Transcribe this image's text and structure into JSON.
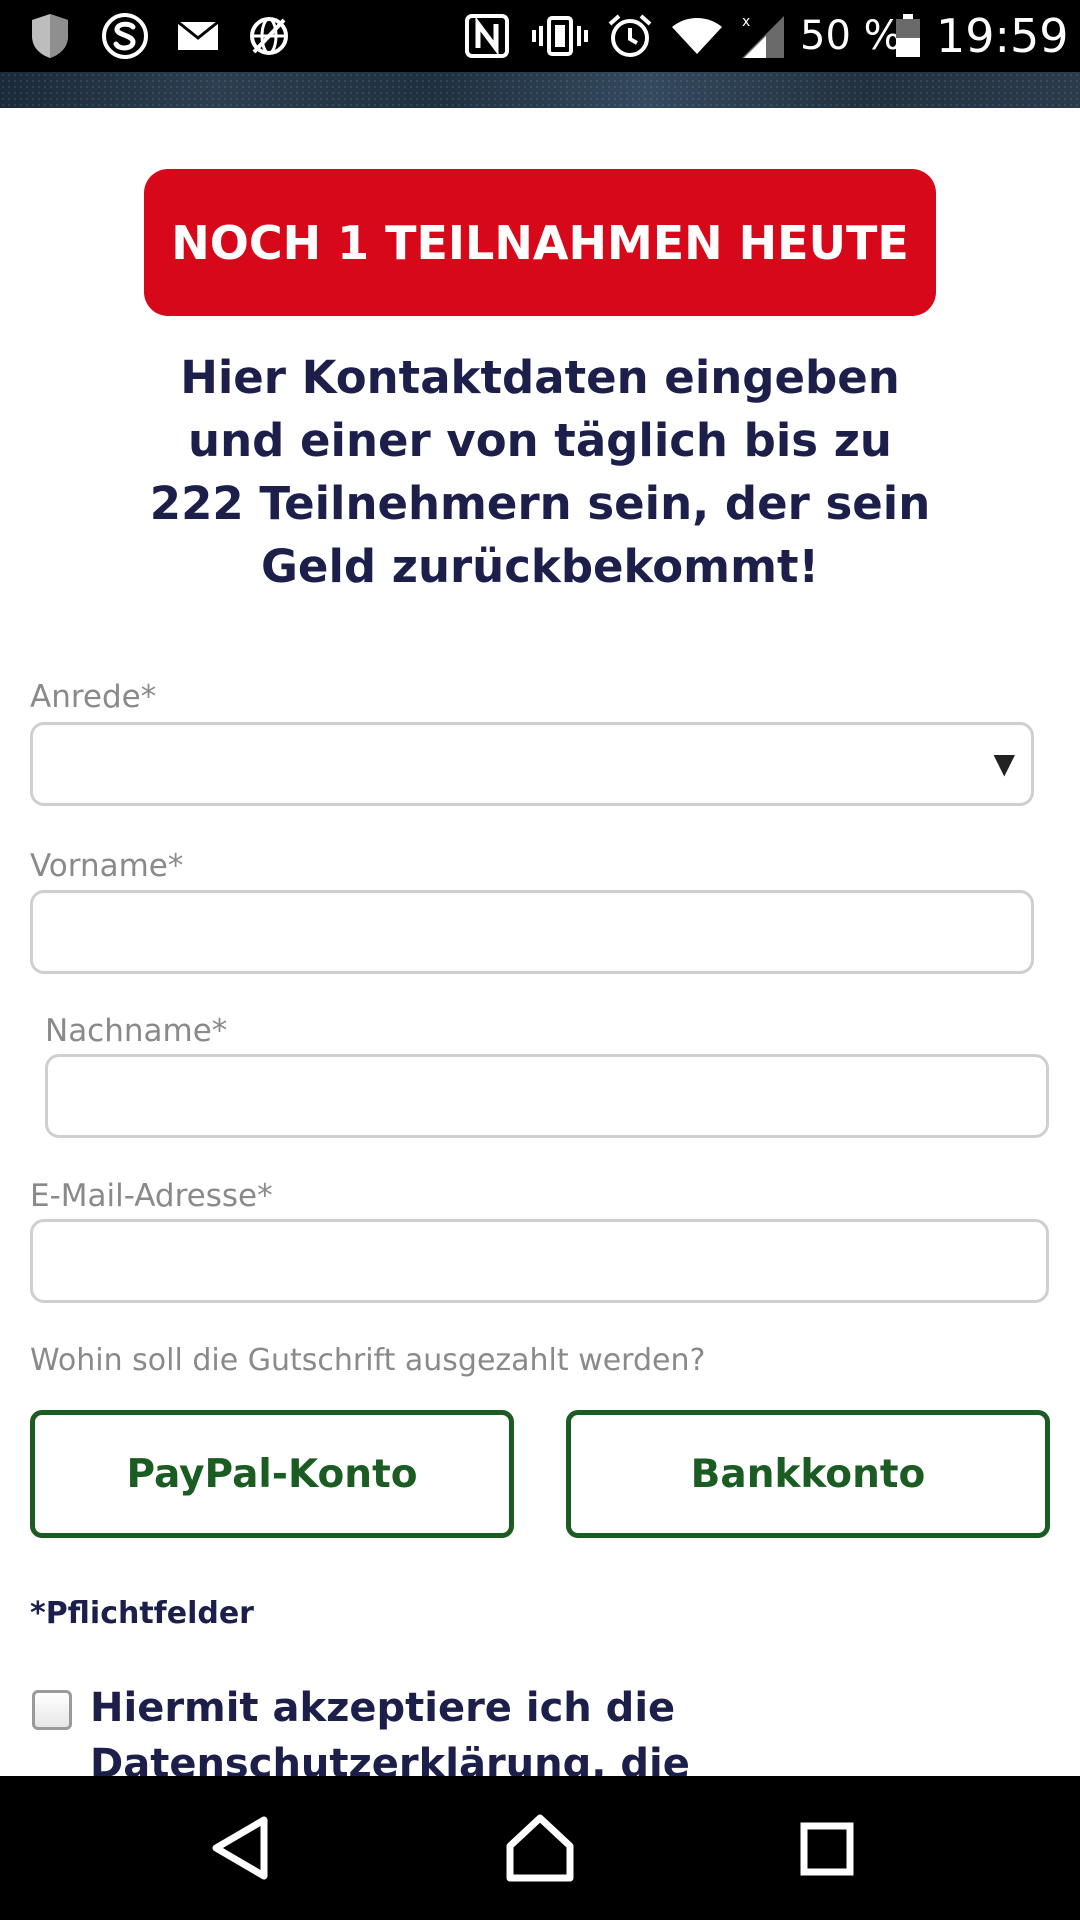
{
  "status_bar": {
    "battery_text": "50 %",
    "clock": "19:59",
    "icons": [
      "shield-icon",
      "skype-icon",
      "mail-icon",
      "globe-blocked-icon",
      "nfc-icon",
      "vibrate-icon",
      "alarm-icon",
      "wifi-icon",
      "cell-signal-icon",
      "battery-icon"
    ]
  },
  "banner": {
    "text": "NOCH 1 TEILNAHMEN HEUTE",
    "color": "#d7081a"
  },
  "headline": {
    "line1": "Hier Kontaktdaten eingeben",
    "line2": "und einer von täglich bis zu",
    "line3": "222 Teilnehmern sein, der sein",
    "line4": "Geld zurückbekommt!"
  },
  "form": {
    "salutation_label": "Anrede*",
    "salutation_value": "",
    "first_name_label": "Vorname*",
    "first_name_value": "",
    "last_name_label": "Nachname*",
    "last_name_value": "",
    "email_label": "E-Mail-Adresse*",
    "email_value": "",
    "payout_question": "Wohin soll die Gutschrift ausgezahlt werden?",
    "paypal_label": "PayPal-Konto",
    "bank_label": "Bankkonto",
    "required_note": "*Pflichtfelder",
    "consent_line1": "Hiermit akzeptiere ich die",
    "consent_line2": "Datenschutzerklärung, die",
    "consent_checked": false
  },
  "colors": {
    "headline": "#1b1f4a",
    "payout_button": "#1a5c22",
    "label": "#8a8a8a"
  },
  "nav_bar": {
    "icons": [
      "back-icon",
      "home-icon",
      "recents-icon"
    ]
  }
}
